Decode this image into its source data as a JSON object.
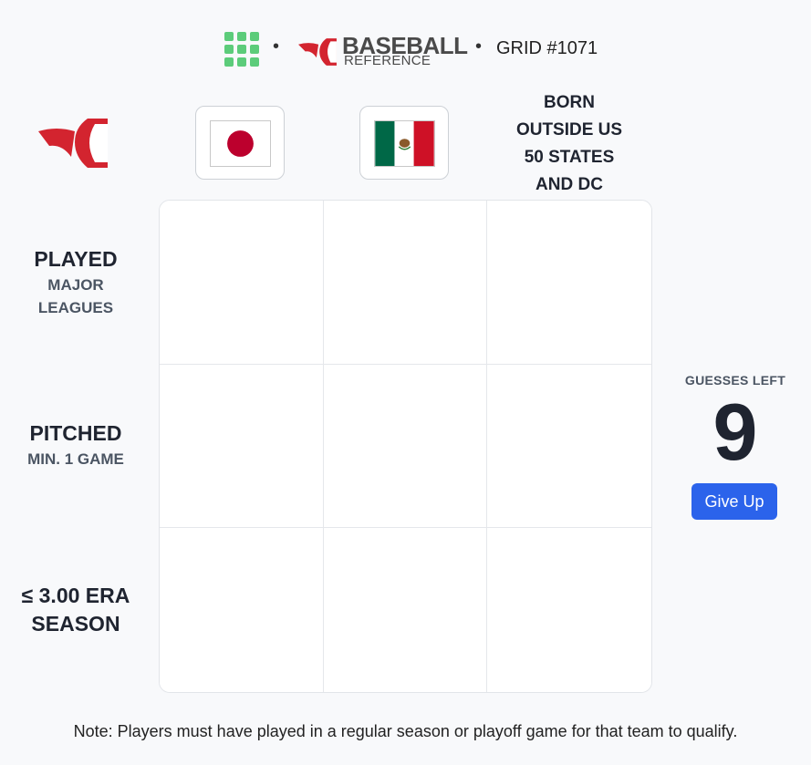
{
  "header": {
    "apps_icon": "grid-apps-icon",
    "separator": "•",
    "brand_top": "BASEBALL",
    "brand_bottom": "REFERENCE",
    "grid_label": "GRID #1071"
  },
  "columns": [
    {
      "type": "icon",
      "icon": "baseball-reference-logo-icon"
    },
    {
      "type": "flag",
      "flag": "japan-flag-icon"
    },
    {
      "type": "flag",
      "flag": "mexico-flag-icon"
    },
    {
      "type": "text",
      "lines": [
        "BORN",
        "OUTSIDE US",
        "50 STATES",
        "AND DC"
      ]
    }
  ],
  "rows": [
    {
      "main": "PLAYED",
      "sub": [
        "MAJOR",
        "LEAGUES"
      ]
    },
    {
      "main": "PITCHED",
      "sub": [
        "MIN. 1 GAME"
      ]
    },
    {
      "main": "≤ 3.00 ERA",
      "main2": "SEASON"
    }
  ],
  "guesses": {
    "label": "GUESSES LEFT",
    "count": "9"
  },
  "give_up_label": "Give Up",
  "note": "Note: Players must have played in a regular season or playoff game for that team to qualify.",
  "colors": {
    "accent": "#2b63eb",
    "logo_red": "#d3242f",
    "apps_green": "#5ccc7a",
    "japan_red": "#bc002d",
    "mexico_green": "#006847",
    "mexico_red": "#ce1126"
  }
}
